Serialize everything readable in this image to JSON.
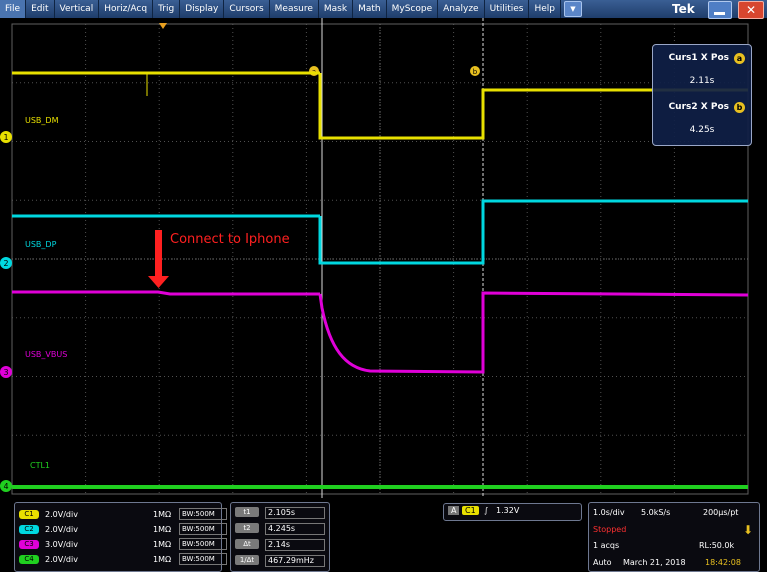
{
  "menu": [
    "File",
    "Edit",
    "Vertical",
    "Horiz/Acq",
    "Trig",
    "Display",
    "Cursors",
    "Measure",
    "Mask",
    "Math",
    "MyScope",
    "Analyze",
    "Utilities",
    "Help"
  ],
  "brand": "Tek",
  "close_glyph": "✕",
  "dropdown_glyph": "▼",
  "cursor_readout": {
    "curs1_label": "Curs1 X Pos",
    "curs1_value": "2.11s",
    "curs1_badge": "a",
    "curs2_label": "Curs2 X Pos",
    "curs2_value": "4.25s",
    "curs2_badge": "b"
  },
  "annotation": "Connect to Iphone",
  "channel_labels": {
    "ch1": "USB_DM",
    "ch2": "USB_DP",
    "ch3": "USB_VBUS",
    "ch4": "CTL1"
  },
  "channel_markers": {
    "ch1": "1",
    "ch2": "2",
    "ch3": "3",
    "ch4": "4"
  },
  "channels": [
    {
      "id": "C1",
      "scale": "2.0V/div",
      "imp": "1MΩ",
      "bw": "BW:500M",
      "color": "#e8e000"
    },
    {
      "id": "C2",
      "scale": "2.0V/div",
      "imp": "1MΩ",
      "bw": "BW:500M",
      "color": "#00d8e0"
    },
    {
      "id": "C3",
      "scale": "3.0V/div",
      "imp": "1MΩ",
      "bw": "BW:500M",
      "color": "#e000d8"
    },
    {
      "id": "C4",
      "scale": "2.0V/div",
      "imp": "1MΩ",
      "bw": "BW:500M",
      "color": "#20d020"
    }
  ],
  "cursor_time": [
    {
      "label": "t1",
      "value": "2.105s"
    },
    {
      "label": "t2",
      "value": "4.245s"
    },
    {
      "label": "Δt",
      "value": "2.14s"
    },
    {
      "label": "1/Δt",
      "value": "467.29mHz"
    }
  ],
  "trigger": {
    "mode": "A",
    "source": "C1",
    "slope": "∫",
    "level": "1.32V"
  },
  "acquisition": {
    "timebase": "1.0s/div",
    "sample_rate": "5.0kS/s",
    "resolution": "200µs/pt",
    "state": "Stopped",
    "acqs": "1 acqs",
    "record_length": "RL:50.0k",
    "mode": "Auto",
    "date": "March 21, 2018",
    "time": "18:42:08"
  },
  "colors": {
    "ch1": "#e8e000",
    "ch2": "#00d8e0",
    "ch3": "#e000d8",
    "ch4": "#20d020",
    "cursor_badge": "#e8c020",
    "menu_bg": "#2b4c80",
    "annotation": "#ff2020"
  }
}
